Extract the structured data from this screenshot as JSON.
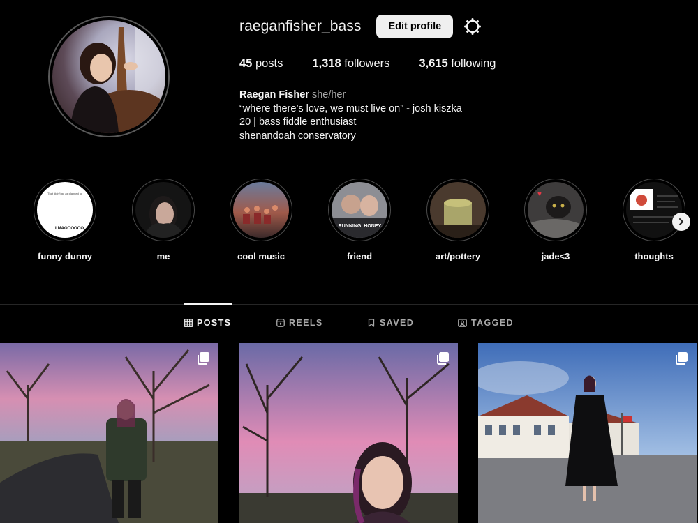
{
  "profile": {
    "username": "raeganfisher_bass",
    "edit_label": "Edit profile",
    "settings_icon": "settings-icon"
  },
  "stats": {
    "posts_count": "45",
    "posts_label": "posts",
    "followers_count": "1,318",
    "followers_label": "followers",
    "following_count": "3,615",
    "following_label": "following"
  },
  "bio": {
    "name": "Raegan Fisher",
    "pronouns": "she/her",
    "lines": [
      "“where there’s love, we must live on” - josh kiszka",
      "20 | bass fiddle enthusiast",
      "shenandoah conservatory"
    ]
  },
  "highlights": [
    {
      "label": "funny dunny",
      "thumb_text_top": "That didn't go as planned lol",
      "thumb_text": "LMAOOOOOO"
    },
    {
      "label": "me"
    },
    {
      "label": "cool music"
    },
    {
      "label": "friend",
      "thumb_text": "RUNNING, HONEY,"
    },
    {
      "label": "art/pottery"
    },
    {
      "label": "jade<3"
    },
    {
      "label": "thoughts"
    }
  ],
  "tabs": [
    {
      "label": "POSTS",
      "icon": "grid-icon",
      "active": true
    },
    {
      "label": "REELS",
      "icon": "reels-icon",
      "active": false
    },
    {
      "label": "SAVED",
      "icon": "bookmark-icon",
      "active": false
    },
    {
      "label": "TAGGED",
      "icon": "tagged-icon",
      "active": false
    }
  ],
  "colors": {
    "background": "#000000",
    "text": "#f5f5f5",
    "muted": "#a8a8a8",
    "button_bg": "#efefef"
  }
}
